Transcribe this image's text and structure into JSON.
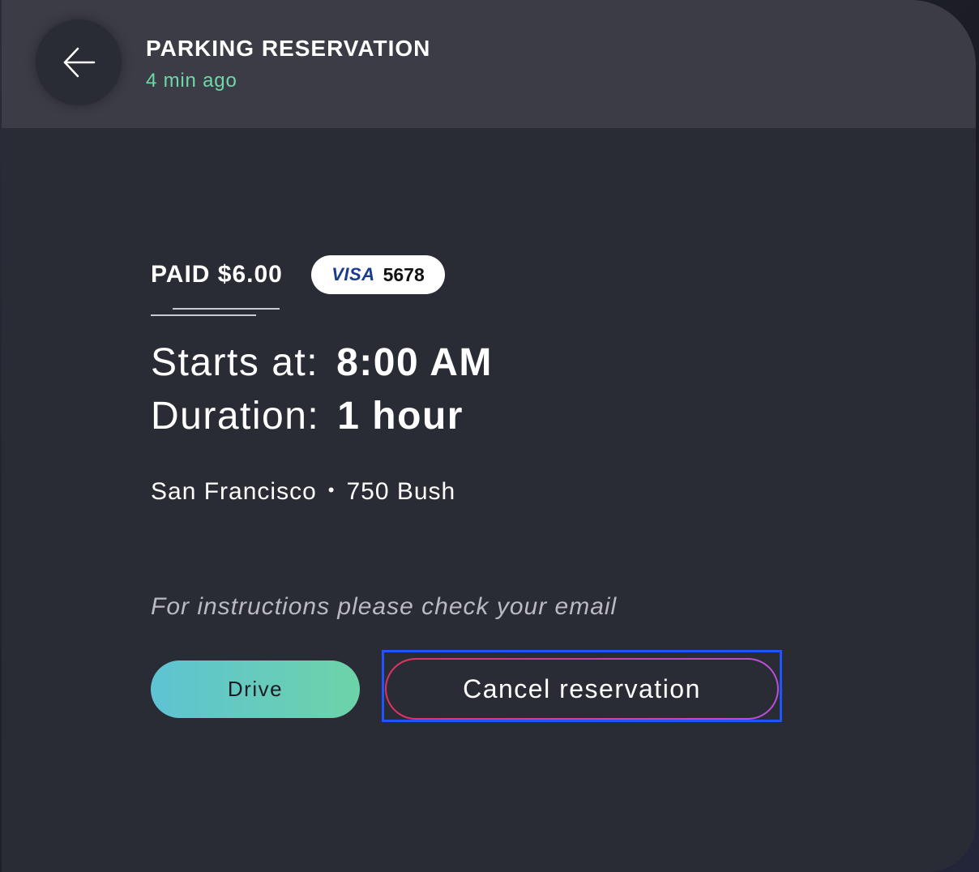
{
  "header": {
    "back_icon": "arrow-left-icon",
    "title": "PARKING RESERVATION",
    "subtitle": "4 min ago"
  },
  "payment": {
    "paid_label": "PAID $6.00",
    "card_brand": "VISA",
    "card_last4": "5678"
  },
  "details": {
    "starts_label": "Starts at:",
    "starts_value": "8:00 AM",
    "duration_label": "Duration:",
    "duration_value": "1 hour"
  },
  "location": {
    "city": "San Francisco",
    "separator": "•",
    "address": "750 Bush"
  },
  "instructions": "For instructions please check your email",
  "actions": {
    "drive_label": "Drive",
    "cancel_label": "Cancel reservation"
  },
  "colors": {
    "accent_green": "#6fd8a8",
    "drive_gradient_start": "#5ec3d3",
    "drive_gradient_end": "#6dd3a8",
    "cancel_gradient_start": "#e0335c",
    "cancel_gradient_end": "#b850d8",
    "focus_outline": "#2054ff"
  }
}
